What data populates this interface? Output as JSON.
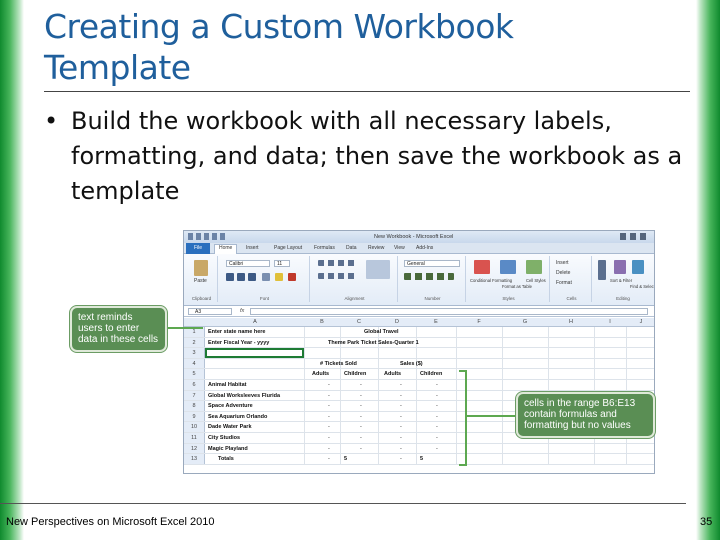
{
  "slide": {
    "title": "Creating a Custom Workbook Template",
    "bullet_symbol": "•",
    "bullet_text": "Build the workbook with all necessary labels, formatting, and data; then save the workbook as a template",
    "footer_left": "New Perspectives on Microsoft Excel 2010",
    "page_number": "35",
    "accent_color": "#1f5f9c",
    "side_bar_color": "#0f8a2e"
  },
  "excel": {
    "window_title": "New Workbook - Microsoft Excel",
    "tabs": [
      "File",
      "Home",
      "Insert",
      "Page Layout",
      "Formulas",
      "Data",
      "Review",
      "View",
      "Add-Ins"
    ],
    "ribbon": {
      "paste_label": "Paste",
      "font_name": "Calibri",
      "font_size": "11",
      "number_format": "General",
      "groups": [
        "Clipboard",
        "Font",
        "Alignment",
        "Number",
        "Styles",
        "Cells",
        "Editing"
      ],
      "styles": [
        "Conditional Formatting",
        "Format as Table",
        "Cell Styles"
      ],
      "cells": [
        "Insert",
        "Delete",
        "Format"
      ],
      "editing": [
        "Sort & Filter",
        "Find & Select"
      ]
    },
    "name_box": "A3",
    "fx_label": "fx",
    "columns": [
      "A",
      "B",
      "C",
      "D",
      "E",
      "F",
      "G",
      "H",
      "I",
      "J"
    ],
    "rows": [
      {
        "n": "1",
        "a": "Enter state name here",
        "c": "Global Travel"
      },
      {
        "n": "2",
        "a": "Enter Fiscal Year - yyyy",
        "c": "Theme Park Ticket Sales-Quarter 1"
      },
      {
        "n": "3",
        "a": ""
      },
      {
        "n": "4",
        "b": "# Tickets Sold",
        "d": "Sales ($)"
      },
      {
        "n": "5",
        "b": "Adults",
        "c": "Children",
        "d": "Adults",
        "e": "Children"
      },
      {
        "n": "6",
        "a": "Animal Habitat",
        "b": "-",
        "c": "-",
        "d": "-",
        "e": "-"
      },
      {
        "n": "7",
        "a": "Global Worksleeves Flurida",
        "b": "-",
        "c": "-",
        "d": "-",
        "e": "-"
      },
      {
        "n": "8",
        "a": "Space Adventure",
        "b": "-",
        "c": "-",
        "d": "-",
        "e": "-"
      },
      {
        "n": "9",
        "a": "Sea Aquarium Orlando",
        "b": "-",
        "c": "-",
        "d": "-",
        "e": "-"
      },
      {
        "n": "10",
        "a": "Dade Water Park",
        "b": "-",
        "c": "-",
        "d": "-",
        "e": "-"
      },
      {
        "n": "11",
        "a": "City Studios",
        "b": "-",
        "c": "-",
        "d": "-",
        "e": "-"
      },
      {
        "n": "12",
        "a": "Magic Playland",
        "b": "-",
        "c": "-",
        "d": "-",
        "e": "-"
      },
      {
        "n": "13",
        "a": "Totals",
        "b": "-",
        "c": "5",
        "d": "-",
        "e": "5"
      }
    ]
  },
  "callouts": {
    "left": "text reminds users to enter data in these cells",
    "right": "cells in the range B6:E13 contain formulas and formatting but no values"
  }
}
